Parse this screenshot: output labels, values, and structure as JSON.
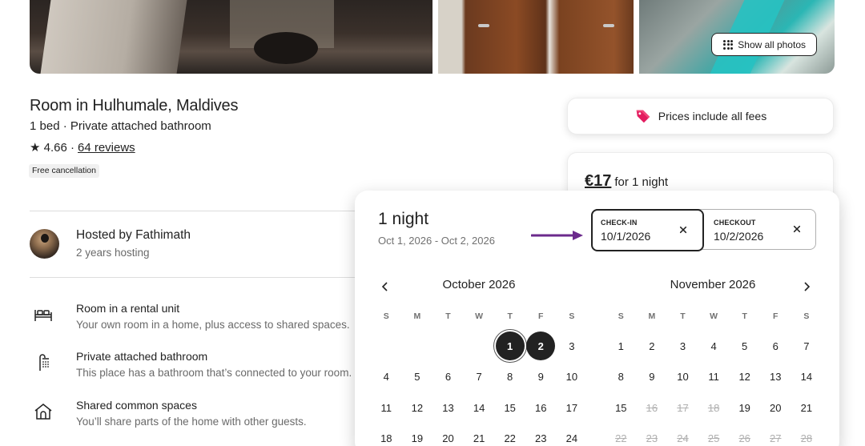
{
  "photos": {
    "show_all_label": "Show all photos"
  },
  "listing": {
    "title": "Room in Hulhumale, Maldives",
    "subtitle": "1 bed · Private attached bathroom",
    "rating_prefix": "★ 4.66 ·",
    "reviews_link": "64 reviews",
    "badge": "Free cancellation"
  },
  "host": {
    "name": "Hosted by Fathimath",
    "years": "2 years hosting"
  },
  "features": [
    {
      "title": "Room in a rental unit",
      "desc": "Your own room in a home, plus access to shared spaces.",
      "icon": "bed-icon"
    },
    {
      "title": "Private attached bathroom",
      "desc": "This place has a bathroom that’s connected to your room.",
      "icon": "shower-icon"
    },
    {
      "title": "Shared common spaces",
      "desc": "You’ll share parts of the home with other guests.",
      "icon": "home-icon"
    }
  ],
  "fees_card": {
    "text": "Prices include all fees",
    "icon": "price-tag-icon",
    "accent": "#e31c5f"
  },
  "price": {
    "amount": "€17",
    "per": "for 1 night"
  },
  "calendar": {
    "nights": "1 night",
    "range": "Oct 1, 2026 - Oct 2, 2026",
    "arrow_color": "#6b2a8c",
    "checkin": {
      "label": "CHECK-IN",
      "value": "10/1/2026"
    },
    "checkout": {
      "label": "CHECKOUT",
      "value": "10/2/2026"
    },
    "months": [
      {
        "name": "October 2026"
      },
      {
        "name": "November 2026"
      }
    ],
    "dow": [
      "S",
      "M",
      "T",
      "W",
      "T",
      "F",
      "S"
    ]
  }
}
